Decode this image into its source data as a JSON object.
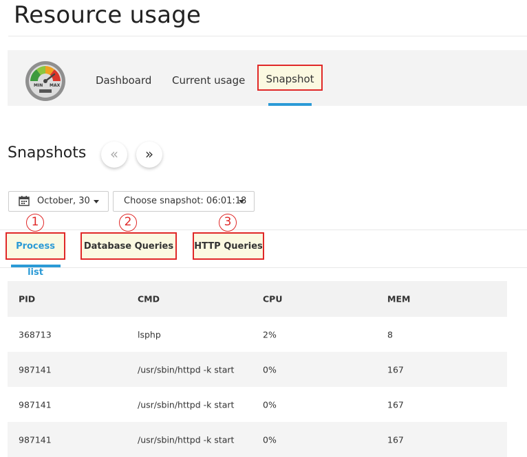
{
  "page": {
    "title": "Resource usage"
  },
  "nav": {
    "logo_min": "MIN",
    "logo_max": "MAX",
    "tabs": [
      {
        "label": "Dashboard"
      },
      {
        "label": "Current usage"
      },
      {
        "label": "Snapshot"
      }
    ],
    "active_tab": "Snapshot",
    "accent": "#2b9ad6",
    "highlight_border": "#e02727"
  },
  "snapshots": {
    "title": "Snapshots",
    "prev_icon": "«",
    "next_icon": "»",
    "date_label": "October, 30",
    "snapshot_label": "Choose snapshot: 06:01:18"
  },
  "badges": [
    "1",
    "2",
    "3"
  ],
  "subtabs": [
    {
      "label": "Process list"
    },
    {
      "label": "Database Queries"
    },
    {
      "label": "HTTP Queries"
    }
  ],
  "table": {
    "headers": [
      "PID",
      "CMD",
      "CPU",
      "MEM"
    ],
    "rows": [
      [
        "368713",
        "lsphp",
        "2%",
        "8"
      ],
      [
        "987141",
        "/usr/sbin/httpd -k start",
        "0%",
        "167"
      ],
      [
        "987141",
        "/usr/sbin/httpd -k start",
        "0%",
        "167"
      ],
      [
        "987141",
        "/usr/sbin/httpd -k start",
        "0%",
        "167"
      ]
    ]
  }
}
